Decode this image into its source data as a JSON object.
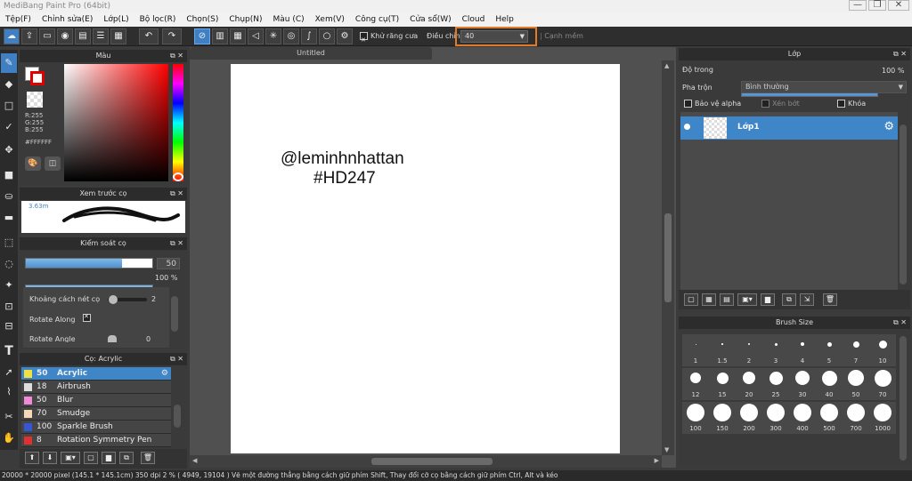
{
  "window": {
    "title": "MediBang Paint Pro (64bit)",
    "min": "—",
    "max": "❐",
    "close": "✕"
  },
  "menu": [
    "Tệp(F)",
    "Chỉnh sửa(E)",
    "Lớp(L)",
    "Bộ lọc(R)",
    "Chọn(S)",
    "Chụp(N)",
    "Màu (C)",
    "Xem(V)",
    "Công cụ(T)",
    "Cửa sổ(W)",
    "Cloud",
    "Help"
  ],
  "toolbar": {
    "antialias_label": "Khử răng cưa",
    "correction_label": "Điều chỉnh",
    "correction_value": "40",
    "edge_label": "Cạnh mềm"
  },
  "color_panel": {
    "title": "Màu",
    "r": "R:255",
    "g": "G:255",
    "b": "B:255",
    "hex": "#FFFFFF",
    "primary": "#ff0000",
    "secondary": "#ffffff"
  },
  "preview_panel": {
    "title": "Xem trước cọ",
    "size": "3.63m"
  },
  "brush_control": {
    "title": "Kiểm soát cọ",
    "size_value": "50",
    "size_fraction": 0.76,
    "opacity_value": "100 %",
    "opacity_fraction": 1.0,
    "spacing_label": "Khoảng cách nét cọ",
    "spacing_value": "2",
    "rotate_along_label": "Rotate Along",
    "rotate_angle_label": "Rotate Angle",
    "rotate_angle_value": "0"
  },
  "brush_list": {
    "title": "Cọ: Acrylic",
    "items": [
      {
        "num": "50",
        "name": "Acrylic",
        "color": "#f0e040",
        "selected": true
      },
      {
        "num": "18",
        "name": "Airbrush",
        "color": "#dddddd",
        "selected": false
      },
      {
        "num": "50",
        "name": "Blur",
        "color": "#f08ad8",
        "selected": false
      },
      {
        "num": "70",
        "name": "Smudge",
        "color": "#f3d9b5",
        "selected": false
      },
      {
        "num": "100",
        "name": "Sparkle Brush",
        "color": "#3557d6",
        "selected": false
      },
      {
        "num": "8",
        "name": "Rotation Symmetry Pen",
        "color": "#e03030",
        "selected": false
      }
    ]
  },
  "canvas": {
    "tab": "Untitled",
    "line1": "@leminhnhattan",
    "line2": "#HD247"
  },
  "layer_panel": {
    "title": "Lớp",
    "opacity_label": "Độ trong",
    "opacity_value": "100 %",
    "opacity_fraction": 1.0,
    "blend_label": "Pha trộn",
    "blend_value": "Bình thường",
    "protect_alpha": "Bảo vệ alpha",
    "clipping": "Xén bớt",
    "lock": "Khóa",
    "layer_name": "Lớp1"
  },
  "brush_size_panel": {
    "title": "Brush Size",
    "sizes": [
      "1",
      "1.5",
      "2",
      "3",
      "4",
      "5",
      "7",
      "10",
      "12",
      "15",
      "20",
      "25",
      "30",
      "40",
      "50",
      "70",
      "100",
      "150",
      "200",
      "300",
      "400",
      "500",
      "700",
      "1000"
    ]
  },
  "status": {
    "canvas_size": "20000 * 20000 pixel",
    "physical_size": "(145.1 * 145.1cm)",
    "dpi": "350 dpi",
    "zoom": "2 %",
    "coords": "( 4949, 19104 )",
    "hint": "Vẽ một đường thẳng bằng cách giữ phím Shift, Thay đổi cỡ cọ bằng cách giữ phím Ctrl, Alt và kéo"
  }
}
